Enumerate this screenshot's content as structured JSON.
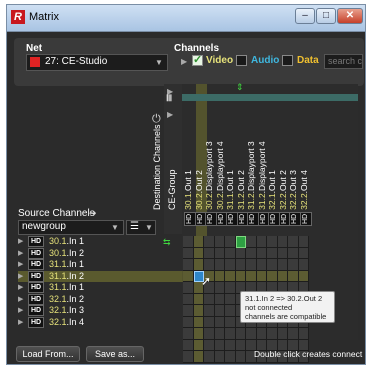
{
  "window": {
    "title": "Matrix",
    "minimize": "–",
    "maximize": "□",
    "close": "✕"
  },
  "net": {
    "label": "Net",
    "value": "27: CE-Studio",
    "color": "#e02323"
  },
  "channels": {
    "label": "Channels",
    "video": "Video",
    "audio": "Audio",
    "data": "Data",
    "video_color": "#e6e27a",
    "audio_color": "#3fb8e0",
    "data_color": "#f0c030",
    "search_placeholder": "search c"
  },
  "destination": {
    "label": "Destination Channels",
    "group_label": "CE-Group"
  },
  "source": {
    "label": "Source Channels",
    "group_value": "newgroup"
  },
  "columns": [
    {
      "a": "30.1",
      "b": ".Out 1"
    },
    {
      "a": "30.2",
      "b": ".Out 2"
    },
    {
      "a": "30.2",
      "b": ".Displayport 3"
    },
    {
      "a": "30.2",
      "b": ".Displayport 4"
    },
    {
      "a": "31.1",
      "b": ".Out 1"
    },
    {
      "a": "31.2",
      "b": ".Out 2"
    },
    {
      "a": "31.2",
      "b": ".Displayport 3"
    },
    {
      "a": "31.2",
      "b": ".Displayport 4"
    },
    {
      "a": "32.1",
      "b": ".Out 1"
    },
    {
      "a": "32.2",
      "b": ".Out 2"
    },
    {
      "a": "32.2",
      "b": ".Out 3"
    },
    {
      "a": "32.2",
      "b": ".Out 4"
    }
  ],
  "hd_tag": "HD",
  "rows": [
    {
      "a": "30.1",
      "b": ".In 1"
    },
    {
      "a": "30.1",
      "b": ".In 2"
    },
    {
      "a": "31.1",
      "b": ".In 1"
    },
    {
      "a": "31.1",
      "b": ".In 2"
    },
    {
      "a": "31.1",
      "b": ".In 1"
    },
    {
      "a": "32.1",
      "b": ".In 2"
    },
    {
      "a": "32.1",
      "b": ".In 3"
    },
    {
      "a": "32.1",
      "b": ".In 4"
    }
  ],
  "tooltip": {
    "line1": "31.1.In 2 => 30.2.Out 2",
    "line2": "not connected",
    "line3": "channels are compatible"
  },
  "footer": {
    "load": "Load From...",
    "save": "Save as...",
    "hint": "Double click creates connect"
  }
}
